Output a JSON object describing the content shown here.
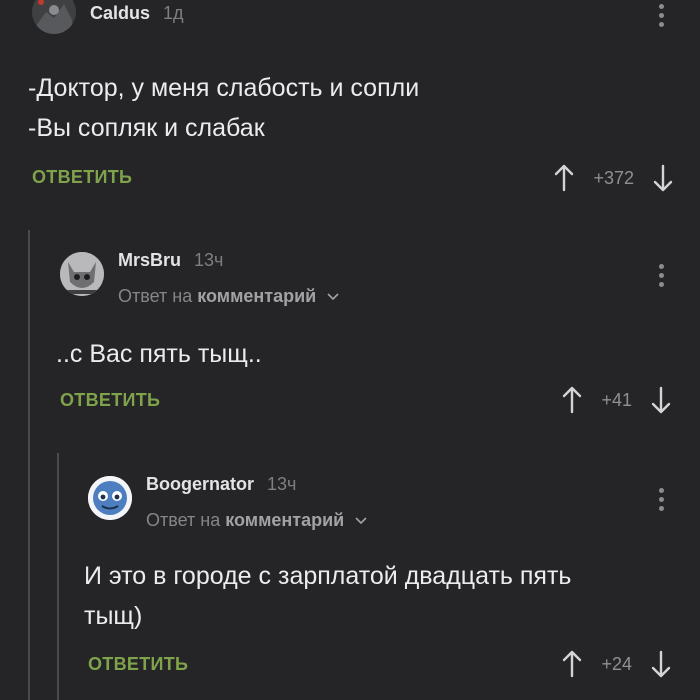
{
  "comments": [
    {
      "author": "Caldus",
      "time": "1д",
      "reply_to_prefix": "",
      "reply_to_link": "",
      "lines": [
        "-Доктор, у меня слабость и сопли",
        "-Вы сопляк и слабак"
      ],
      "reply_label": "ОТВЕТИТЬ",
      "rating": "+372"
    },
    {
      "author": "MrsBru",
      "time": "13ч",
      "reply_to_prefix": "Ответ на",
      "reply_to_link": "комментарий",
      "lines": [
        "..с Вас пять тыщ.."
      ],
      "reply_label": "ОТВЕТИТЬ",
      "rating": "+41"
    },
    {
      "author": "Boogernator",
      "time": "13ч",
      "reply_to_prefix": "Ответ на",
      "reply_to_link": "комментарий",
      "lines": [
        "И это в городе с зарплатой двадцать пять",
        "тыщ)"
      ],
      "reply_label": "ОТВЕТИТЬ",
      "rating": "+24"
    }
  ],
  "colors": {
    "background": "#252527",
    "accent_reply": "#7ea34a",
    "thread_line": "#4b4b4f"
  },
  "icons": [
    "more-vertical-icon",
    "arrow-up-icon",
    "arrow-down-icon",
    "chevron-down-icon"
  ]
}
